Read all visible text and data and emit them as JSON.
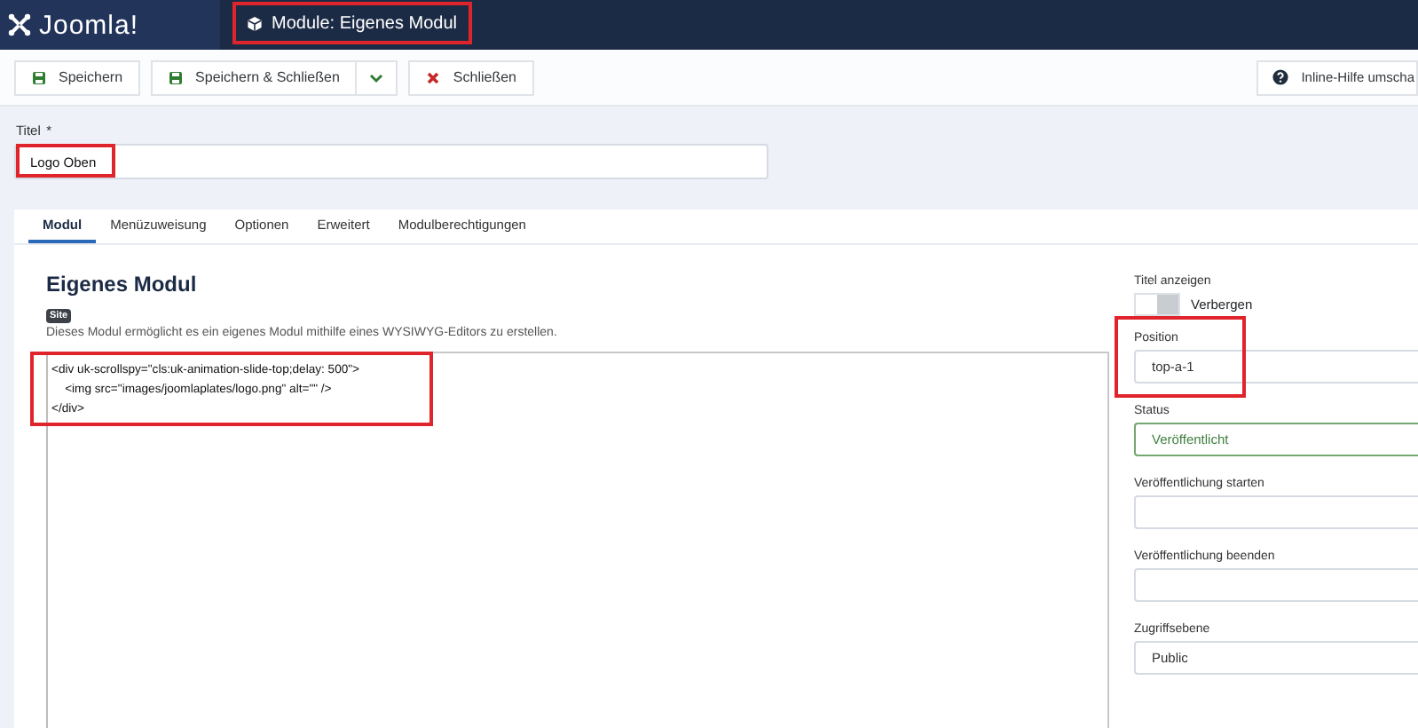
{
  "header": {
    "logo": "Joomla!",
    "title": "Module: Eigenes Modul",
    "title_highlighted": true
  },
  "toolbar": {
    "buttons": [
      {
        "kind": "save",
        "label": "Speichern"
      },
      {
        "kind": "save-close",
        "label": "Speichern & Schließen"
      },
      {
        "kind": "dropdown"
      },
      {
        "kind": "close",
        "label": "Schließen"
      }
    ],
    "help": "Inline-Hilfe umscha"
  },
  "title_field": {
    "label": "Titel",
    "required_mark": "*",
    "value": "Logo Oben",
    "highlighted": true
  },
  "tabs": [
    {
      "label": "Modul",
      "selected": true
    },
    {
      "label": "Menüzuweisung",
      "selected": false
    },
    {
      "label": "Optionen",
      "selected": false
    },
    {
      "label": "Erweitert",
      "selected": false
    },
    {
      "label": "Modulberechtigungen",
      "selected": false
    }
  ],
  "module": {
    "heading": "Eigenes Modul",
    "badge": "Site",
    "description": "Dieses Modul ermöglicht es ein eigenes Modul mithilfe eines WYSIWYG-Editors zu erstellen.",
    "code_highlighted": true,
    "code_lines": [
      "<div uk-scrollspy=\"cls:uk-animation-slide-top;delay: 500\">",
      "\t<img src=\"images/joomlaplates/logo.png\" alt=\"\" />",
      "</div>"
    ]
  },
  "sidebar": [
    {
      "kind": "toggle",
      "label": "Titel anzeigen",
      "on": false,
      "value": "Verbergen",
      "highlighted": false
    },
    {
      "kind": "select",
      "label": "Position",
      "value": "top-a-1",
      "highlighted": true,
      "valid": false
    },
    {
      "kind": "select",
      "label": "Status",
      "value": "Veröffentlicht",
      "highlighted": false,
      "valid": true
    },
    {
      "kind": "date",
      "label": "Veröffentlichung starten",
      "highlighted": false
    },
    {
      "kind": "date",
      "label": "Veröffentlichung beenden",
      "highlighted": false
    },
    {
      "kind": "select",
      "label": "Zugriffsebene",
      "value": "Public",
      "highlighted": false,
      "valid": false
    }
  ]
}
